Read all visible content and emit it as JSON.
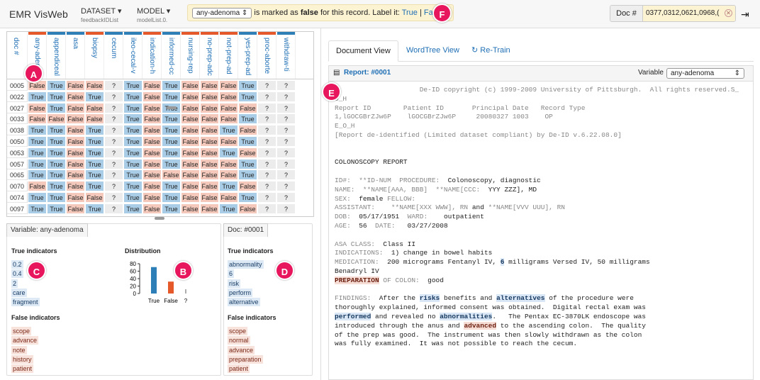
{
  "app": {
    "title": "EMR VisWeb"
  },
  "nav": {
    "dataset": {
      "label": "DATASET",
      "sub": "feedbackIDList"
    },
    "model": {
      "label": "MODEL",
      "sub": "modelList.0."
    }
  },
  "feedback": {
    "variable": "any-adenoma",
    "prefix": "is marked as",
    "value": "false",
    "suffix": "for this record. Label it:",
    "true_label": "True",
    "sep": "|",
    "false_label": "False"
  },
  "doc": {
    "label": "Doc #",
    "value": "0377,0312,0621,0968,("
  },
  "badges": {
    "a": "A",
    "b": "B",
    "c": "C",
    "d": "D",
    "e": "E",
    "f": "F"
  },
  "grid": {
    "columns": [
      "doc #",
      "any-adenoma",
      "appendiceal",
      "asa",
      "biopsy",
      "cecum",
      "ileo-cecal-v",
      "indication-h",
      "informed-cc",
      "nursing-rep",
      "no-prep-adc",
      "not-prep-ad",
      "yes-prep-ad",
      "proc-aborte",
      "withdraw-ti"
    ],
    "rows": [
      {
        "id": "0005",
        "v": [
          "False",
          "True",
          "False",
          "False",
          "?",
          "True",
          "False",
          "True",
          "False",
          "False",
          "False",
          "True",
          "?",
          "?"
        ]
      },
      {
        "id": "0022",
        "v": [
          "True",
          "True",
          "False",
          "True",
          "?",
          "True",
          "False",
          "True",
          "False",
          "False",
          "False",
          "True",
          "?",
          "?"
        ]
      },
      {
        "id": "0027",
        "v": [
          "False",
          "True",
          "False",
          "False",
          "?",
          "True",
          "False",
          "True",
          "False",
          "False",
          "False",
          "False",
          "?",
          "?"
        ]
      },
      {
        "id": "0033",
        "v": [
          "False",
          "False",
          "False",
          "False",
          "?",
          "True",
          "False",
          "True",
          "False",
          "False",
          "False",
          "True",
          "?",
          "?"
        ]
      },
      {
        "id": "0038",
        "v": [
          "True",
          "True",
          "False",
          "True",
          "?",
          "True",
          "False",
          "True",
          "False",
          "False",
          "True",
          "False",
          "?",
          "?"
        ]
      },
      {
        "id": "0050",
        "v": [
          "True",
          "True",
          "False",
          "True",
          "?",
          "True",
          "False",
          "True",
          "False",
          "False",
          "False",
          "True",
          "?",
          "?"
        ]
      },
      {
        "id": "0053",
        "v": [
          "True",
          "True",
          "False",
          "True",
          "?",
          "True",
          "False",
          "True",
          "False",
          "False",
          "True",
          "False",
          "?",
          "?"
        ]
      },
      {
        "id": "0057",
        "v": [
          "True",
          "True",
          "False",
          "True",
          "?",
          "True",
          "False",
          "True",
          "False",
          "False",
          "False",
          "True",
          "?",
          "?"
        ]
      },
      {
        "id": "0065",
        "v": [
          "True",
          "True",
          "False",
          "True",
          "?",
          "True",
          "False",
          "False",
          "False",
          "False",
          "False",
          "True",
          "?",
          "?"
        ]
      },
      {
        "id": "0070",
        "v": [
          "False",
          "True",
          "False",
          "True",
          "?",
          "True",
          "False",
          "True",
          "False",
          "False",
          "True",
          "False",
          "?",
          "?"
        ]
      },
      {
        "id": "0074",
        "v": [
          "True",
          "True",
          "False",
          "False",
          "?",
          "True",
          "False",
          "True",
          "False",
          "False",
          "False",
          "True",
          "?",
          "?"
        ]
      },
      {
        "id": "0097",
        "v": [
          "True",
          "True",
          "False",
          "True",
          "?",
          "True",
          "False",
          "True",
          "False",
          "False",
          "True",
          "False",
          "?",
          "?"
        ]
      }
    ],
    "selected_row": "0005"
  },
  "variable_panel": {
    "tab": "Variable: any-adenoma",
    "true_title": "True indicators",
    "true_items": [
      "0.2",
      "0.4",
      "2",
      "care",
      "fragment"
    ],
    "false_title": "False indicators",
    "false_items": [
      "scope",
      "advance",
      "note",
      "history",
      "patient"
    ],
    "dist_title": "Distribution",
    "colors": {
      "true": "#2e7fb7",
      "false": "#e4582a"
    }
  },
  "chart_data": {
    "type": "bar",
    "title": "Distribution",
    "categories": [
      "True",
      "False",
      "?"
    ],
    "values": [
      71,
      32,
      0
    ],
    "ylim": [
      0,
      80
    ],
    "yticks": [
      0,
      20,
      40,
      60,
      80
    ]
  },
  "doc_panel": {
    "tab": "Doc: #0001",
    "true_title": "True indicators",
    "true_items": [
      "abnormality",
      "6",
      "risk",
      "perform",
      "alternative"
    ],
    "false_title": "False indicators",
    "false_items": [
      "scope",
      "normal",
      "advance",
      "preparation",
      "patient"
    ]
  },
  "right": {
    "tabs": [
      "Document View",
      "WordTree View",
      "Re-Train"
    ],
    "report_title": "Report: #0001",
    "variable_label": "Variable",
    "variable_value": "any-adenoma"
  },
  "report": {
    "l1": "                     De-ID copyright (c) 1999-2009 University of Pittsburgh.  All rights reserved.S_",
    "l2": "O_H",
    "l3": "Report ID        Patient ID       Principal Date   Record Type",
    "l4": "1,lGOCGBrZJw6P    lGOCGBrZJw6P     20080327 1003    OP",
    "l5": "E_O_H",
    "l6": "[Report de-identified (Limited dataset compliant) by De-ID v.6.22.08.0]",
    "l7": "COLONOSCOPY REPORT",
    "l8a": "ID#:  **ID-NUM  PROCEDURE:  ",
    "l8b": "Colonoscopy, diagnostic",
    "l9a": "NAME:  **NAME[AAA, BBB]  **NAME[CCC:  ",
    "l9b": "YYY ZZZ], MD",
    "l10a": "SEX:  ",
    "l10b": "female",
    "l10c": " FELLOW:",
    "l11a": "ASSISTANT:    **NAME[XXX WWW], RN ",
    "l11b": "and",
    "l11c": " **NAME[VVV UUU], RN",
    "l12a": "DOB:  ",
    "l12b": "05/17/1951",
    "l12c": "  WARD:    ",
    "l12d": "outpatient",
    "l13a": "AGE:  ",
    "l13b": "56",
    "l13c": "  DATE:   ",
    "l13d": "03/27/2008",
    "l14a": "ASA CLASS:  ",
    "l14b": "Class II",
    "l15a": "INDICATIONS:  ",
    "l15b": "1) change in bowel habits",
    "l16a": "MEDICATION:  ",
    "l16b": "200 micrograms Fentanyl IV, ",
    "l16c": "6",
    "l16d": " milligrams Versed IV, 50 milligrams",
    "l17": "Benadryl IV",
    "l18a": "PREPARATION",
    "l18b": " OF COLON:  ",
    "l18c": "good",
    "f1a": "FINDINGS:  ",
    "f1b": "After the ",
    "f1c": "risks",
    "f1d": " benefits and ",
    "f1e": "alternatives",
    "f1f": " of the procedure were",
    "f2": "thoroughly explained, informed consent was obtained.  Digital rectal exam was",
    "f3a": "performed",
    "f3b": " and revealed no ",
    "f3c": "abnormalities",
    "f3d": ".   The Pentax EC-3870LK endoscope was",
    "f4a": "introduced through the anus and ",
    "f4b": "advanced",
    "f4c": " to the ascending colon.  The quality",
    "f5": "of the prep was good.  The instrument was then slowly withdrawn as the colon",
    "f6": "was fully examined.  It was not possible to reach the cecum."
  }
}
